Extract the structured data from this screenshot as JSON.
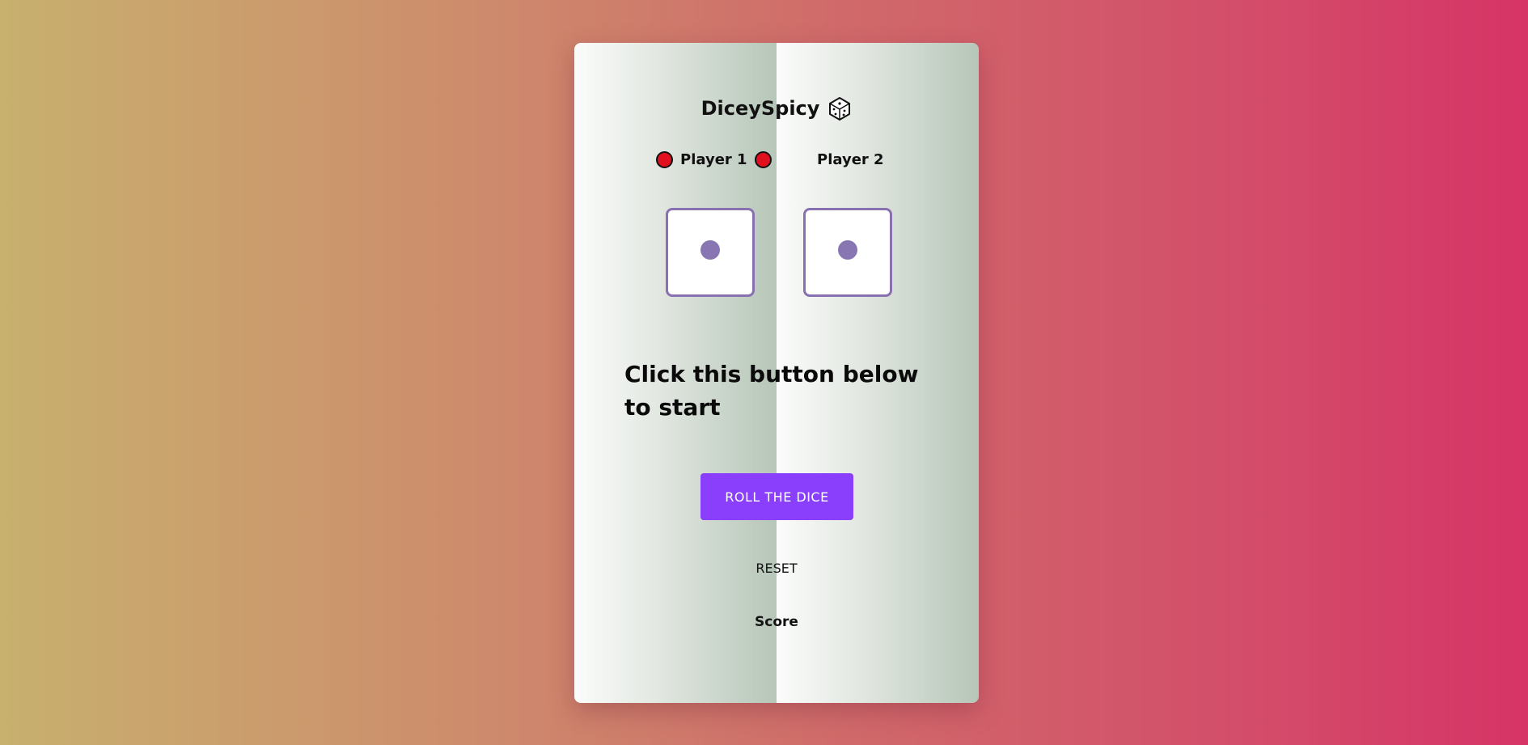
{
  "app": {
    "title": "DiceySpicy",
    "title_icon": "dice-icon"
  },
  "players": [
    {
      "name": "Player 1",
      "active": true
    },
    {
      "name": "Player 2",
      "active": false
    }
  ],
  "dice": [
    {
      "value": 1
    },
    {
      "value": 1
    }
  ],
  "message": "Click this button below to start",
  "buttons": {
    "roll_label": "ROLL THE DICE",
    "reset_label": "RESET"
  },
  "score": {
    "label": "Score"
  },
  "colors": {
    "accent": "#8a3ffc",
    "die_border": "#8970b0",
    "pip": "#8876b2",
    "turn_indicator": "#e0101e"
  }
}
